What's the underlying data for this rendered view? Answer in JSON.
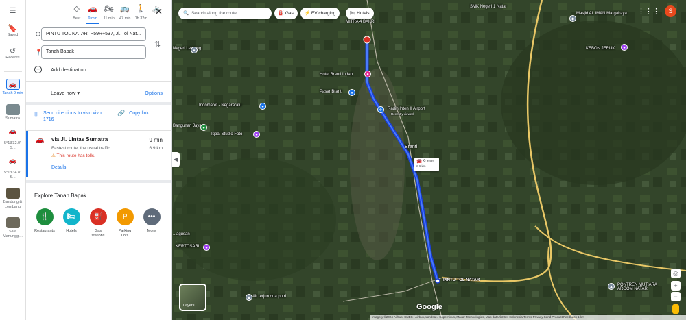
{
  "rail": {
    "saved": "Saved",
    "recents": "Recents",
    "places": [
      {
        "label": "Tanah 9 min",
        "active": true
      },
      {
        "label": "Sumatra"
      },
      {
        "label": "5°13'32.0\" S..."
      },
      {
        "label": "5°13'34.8\" S..."
      },
      {
        "label": "Bandung & Lembang"
      },
      {
        "label": "Sala Manunggi..."
      }
    ]
  },
  "modes": [
    {
      "name": "Best",
      "icon": "◇"
    },
    {
      "name": "9 min",
      "icon": "🚗",
      "active": true
    },
    {
      "name": "11 min",
      "icon": "🏍"
    },
    {
      "name": "47 min",
      "icon": "🚌"
    },
    {
      "name": "1h 32m",
      "icon": "🚶"
    },
    {
      "name": "",
      "icon": "🚲"
    }
  ],
  "directions": {
    "origin": "PINTU TOL NATAR, P59R+537, Jl. Tol Nat...",
    "destination": "Tanah Bapak",
    "add_destination": "Add destination",
    "leave_now": "Leave now ▾",
    "options": "Options",
    "send": "Send directions to vivo vivo 1716",
    "copy_link": "Copy link"
  },
  "route": {
    "title": "via Jl. Lintas Sumatra",
    "time": "9 min",
    "distance": "6.9 km",
    "subtitle": "Fastest route, the usual traffic",
    "warning": "This route has tolls.",
    "details": "Details"
  },
  "explore": {
    "title": "Explore Tanah Bapak",
    "categories": [
      {
        "label": "Restaurants",
        "color": "#1e8e3e",
        "icon": "🍴"
      },
      {
        "label": "Hotels",
        "color": "#12b5cb",
        "icon": "🛏"
      },
      {
        "label": "Gas stations",
        "color": "#d93025",
        "icon": "⛽"
      },
      {
        "label": "Parking Lots",
        "color": "#f29900",
        "icon": "P"
      },
      {
        "label": "More",
        "color": "#5f6b7a",
        "icon": "•••"
      }
    ]
  },
  "map": {
    "search_placeholder": "Search along the route",
    "chips": [
      "Gas",
      "EV charging",
      "Hotels"
    ],
    "avatar": "S",
    "duration_time": "9 min",
    "duration_dist": "6.9 km",
    "layers": "Layers",
    "google": "Google",
    "labels": {
      "smk": "SMK Negeri 1 Natar",
      "masjid": "Masjid AL IMAN Margakaya",
      "mitra": "MITRA 4 BAKRI",
      "kebon": "KEBON JERUK",
      "negeri": "Negeri Lemeng",
      "hotel": "Hotel Branti Indah",
      "pasar": "Pasar Branti",
      "indomaret": "Indomaret - Negararatu",
      "radin": "Radin Inten II Airport",
      "recently": "Recently viewed",
      "iqbal": "Iqbal Studio Foto",
      "bangunan": "Bangunan Jaya",
      "branti": "Branti",
      "pintu": "PINTU TOL NATAR",
      "kertosari": "KERTOSARI",
      "air": "Air terjun dua putri",
      "pontren": "PONTREN MUTIARA AROOM NATAR",
      "gusan": "...agusan"
    },
    "footer": "Imagery ©2024 Airbus, CNES / Airbus, Landsat / Copernicus, Maxar Technologies, Map data ©2024   Indonesia   Terms   Privacy   Send Product Feedback   1 km"
  }
}
